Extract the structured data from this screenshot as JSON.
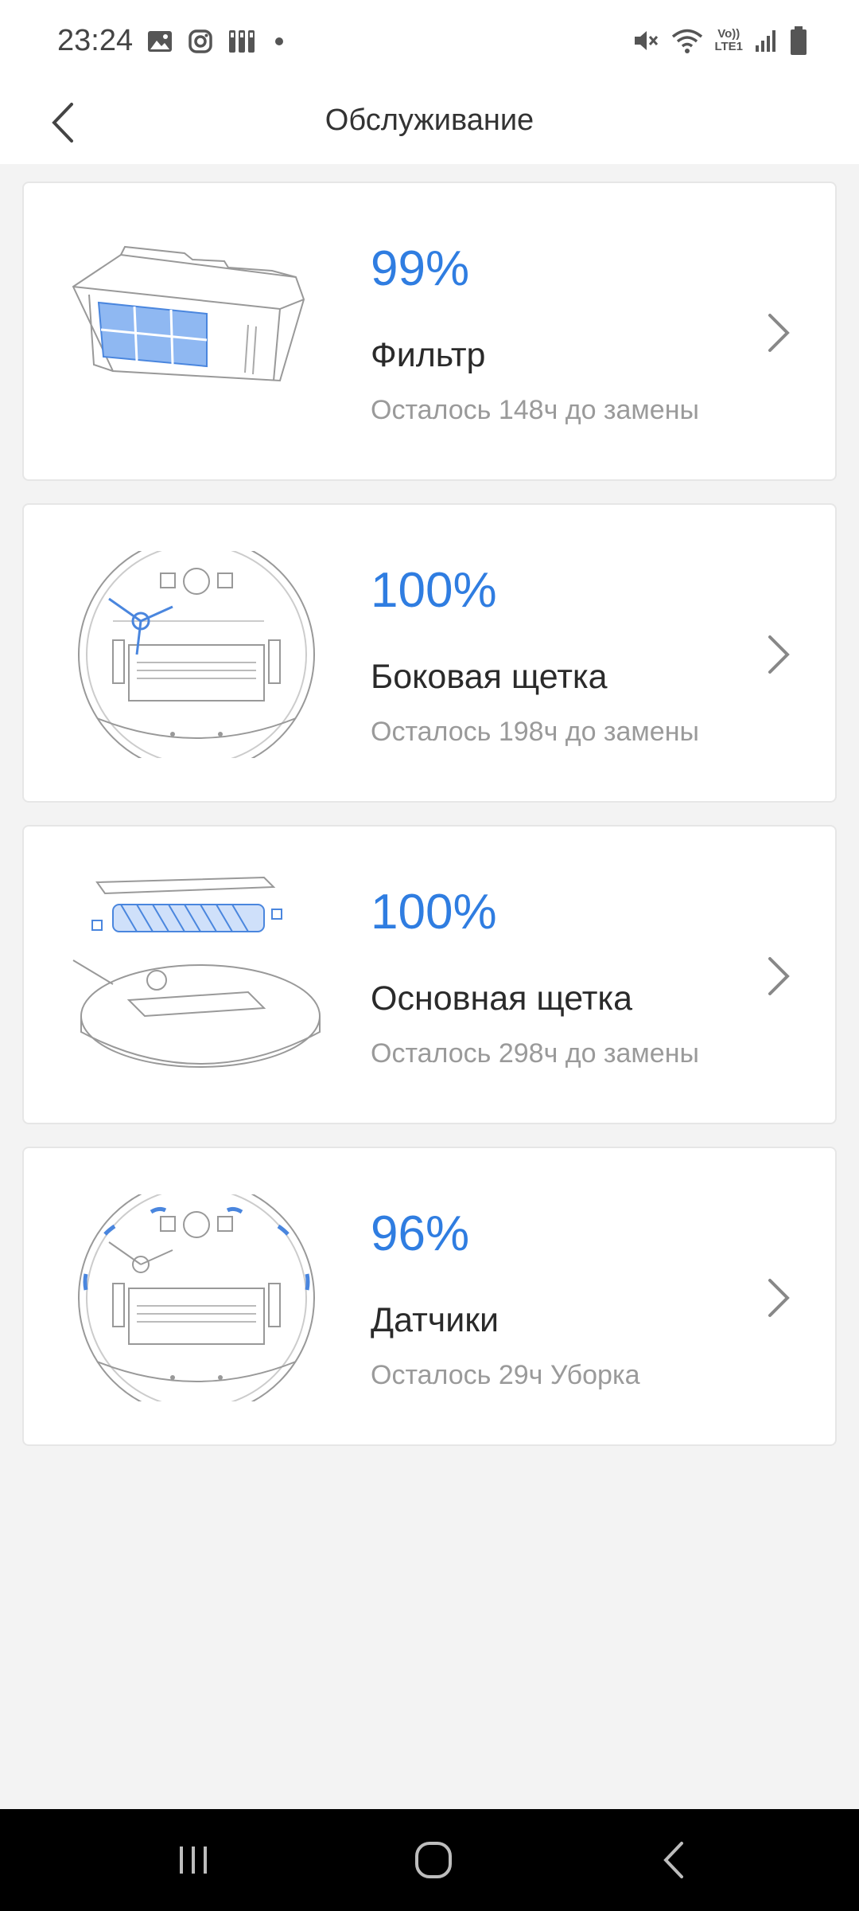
{
  "status_bar": {
    "time": "23:24",
    "left_icons": [
      "gallery-icon",
      "instagram-icon",
      "app-icon",
      "dot-icon"
    ],
    "right_icons": [
      "mute-icon",
      "wifi-icon",
      "volte-icon",
      "signal-icon",
      "battery-icon"
    ],
    "volte_label_top": "Vo))",
    "volte_label_bottom": "LTE1"
  },
  "header": {
    "title": "Обслуживание"
  },
  "items": [
    {
      "percent": "99%",
      "name": "Фильтр",
      "remaining": "Осталось 148ч до замены"
    },
    {
      "percent": "100%",
      "name": "Боковая щетка",
      "remaining": "Осталось 198ч до замены"
    },
    {
      "percent": "100%",
      "name": "Основная щетка",
      "remaining": "Осталось 298ч до замены"
    },
    {
      "percent": "96%",
      "name": "Датчики",
      "remaining": "Осталось 29ч Уборка"
    }
  ],
  "colors": {
    "accent": "#2f7de1",
    "background": "#f3f3f3",
    "card": "#ffffff"
  }
}
